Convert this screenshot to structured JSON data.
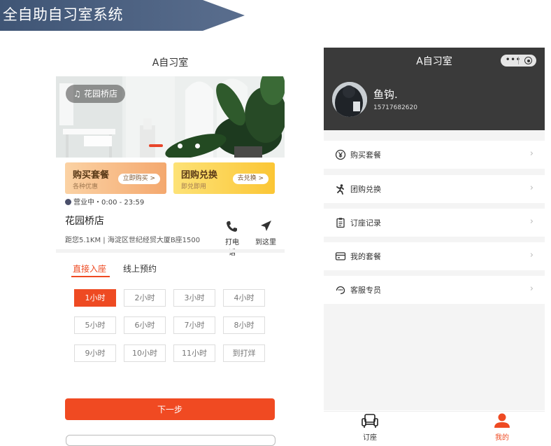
{
  "banner": {
    "title": "全自助自习室系统"
  },
  "left": {
    "title": "A自习室",
    "store_pill": "花园桥店",
    "cards": {
      "buy": {
        "title": "购买套餐",
        "sub": "各种优惠",
        "button": "立即购买 >"
      },
      "group": {
        "title": "团购兑换",
        "sub": "即兑即用",
        "button": "去兑换 >"
      }
    },
    "status": "营业中・0:00 - 23:59",
    "store_name": "花园桥店",
    "address": "距您5.1KM | 海淀区世纪经贸大厦B座1500",
    "actions": {
      "call": "打电话",
      "navigate": "到这里"
    },
    "tabs": {
      "direct": "直接入座",
      "online": "线上预约"
    },
    "hours": [
      "1小时",
      "2小时",
      "3小时",
      "4小时",
      "5小时",
      "6小时",
      "7小时",
      "8小时",
      "9小时",
      "10小时",
      "11小时",
      "到打烊"
    ],
    "selected_hour": "1小时",
    "next_button": "下一步"
  },
  "right": {
    "title": "A自习室",
    "user": {
      "name": "鱼钩.",
      "phone": "15717682620"
    },
    "menu": [
      {
        "label": "购买套餐",
        "icon": "yen-circle-icon"
      },
      {
        "label": "团购兑换",
        "icon": "person-run-icon"
      },
      {
        "label": "订座记录",
        "icon": "clipboard-icon"
      },
      {
        "label": "我的套餐",
        "icon": "card-icon"
      },
      {
        "label": "客服专员",
        "icon": "service-icon"
      }
    ],
    "tabbar": {
      "booking": "订座",
      "mine": "我的"
    }
  },
  "colors": {
    "accent": "#ee4a22",
    "header_dark": "#3a3a3a",
    "banner": "#4a5e7e"
  }
}
